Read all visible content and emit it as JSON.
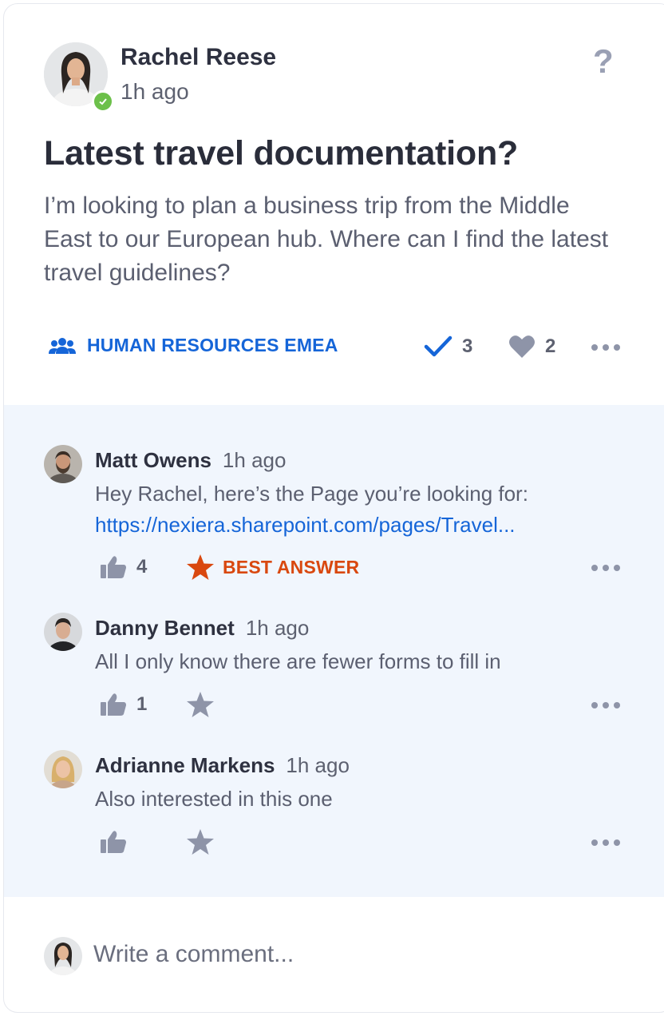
{
  "post": {
    "author": "Rachel Reese",
    "time": "1h ago",
    "title": "Latest travel documentation?",
    "body": "I’m looking to plan a business trip from the Middle East to our European hub. Where can I find the latest travel guidelines?",
    "group": "HUMAN RESOURCES EMEA",
    "answers_count": "3",
    "likes_count": "2",
    "help_icon": "?"
  },
  "comments": [
    {
      "author": "Matt Owens",
      "time": "1h ago",
      "text": "Hey Rachel, here’s the Page you’re looking for:",
      "link": "https://nexiera.sharepoint.com/pages/Travel...",
      "likes": "4",
      "best_answer_label": "BEST ANSWER"
    },
    {
      "author": "Danny Bennet",
      "time": "1h ago",
      "text": "All I only know there are fewer forms to fill in",
      "likes": "1"
    },
    {
      "author": "Adrianne Markens",
      "time": "1h ago",
      "text": "Also interested in this one",
      "likes": ""
    }
  ],
  "composer": {
    "placeholder": "Write a comment..."
  },
  "colors": {
    "accent": "#1565d8",
    "best_answer": "#d9480f",
    "online": "#6cc04a",
    "comments_bg": "#f1f6fd",
    "muted_icon": "#8e94a8"
  },
  "icons": [
    "group-icon",
    "checkmark-icon",
    "heart-icon",
    "more-icon",
    "thumbs-up-icon",
    "star-icon",
    "help-icon"
  ]
}
